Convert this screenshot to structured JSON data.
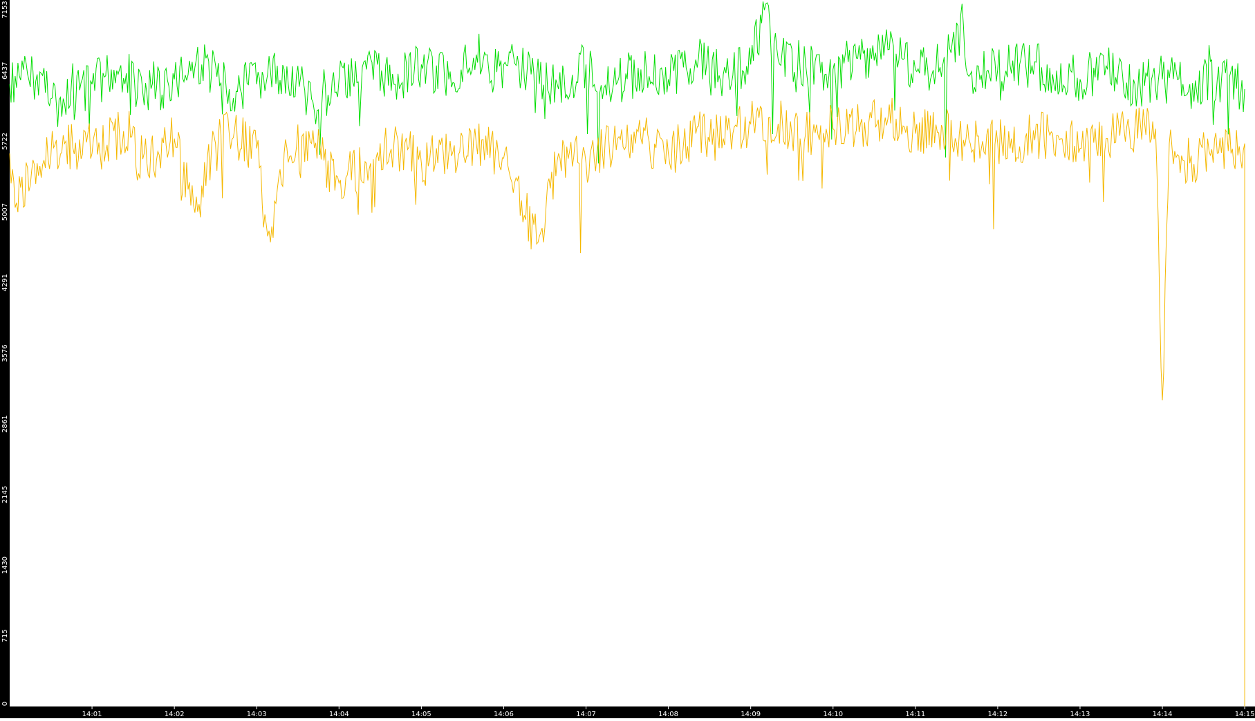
{
  "chart_data": {
    "type": "line",
    "title": "",
    "xlabel": "",
    "ylabel": "",
    "ylim": [
      0,
      7153
    ],
    "xlim": [
      "14:00",
      "14:15"
    ],
    "grid": false,
    "legend": "none",
    "y_ticks": [
      "0",
      "715",
      "1430",
      "2145",
      "2861",
      "3576",
      "4291",
      "5007",
      "5722",
      "6437",
      "7153"
    ],
    "x_ticks": [
      "14:01",
      "14:02",
      "14:03",
      "14:04",
      "14:05",
      "14:06",
      "14:07",
      "14:08",
      "14:09",
      "14:10",
      "14:11",
      "14:12",
      "14:13",
      "14:14",
      "14:15"
    ],
    "series": [
      {
        "color": "#00dd00",
        "points": [
          [
            "14:00",
            6300
          ],
          [
            "14:00:20",
            6400
          ],
          [
            "14:00:40",
            6100
          ],
          [
            "14:01",
            6300
          ],
          [
            "14:01:20",
            6450
          ],
          [
            "14:01:40",
            6200
          ],
          [
            "14:02",
            6350
          ],
          [
            "14:02:20",
            6500
          ],
          [
            "14:02:40",
            6250
          ],
          [
            "14:03",
            6300
          ],
          [
            "14:03:20",
            6450
          ],
          [
            "14:03:40",
            6150
          ],
          [
            "14:04",
            6350
          ],
          [
            "14:04:20",
            6450
          ],
          [
            "14:04:40",
            6300
          ],
          [
            "14:05",
            6500
          ],
          [
            "14:05:20",
            6350
          ],
          [
            "14:05:40",
            6600
          ],
          [
            "14:06",
            6500
          ],
          [
            "14:06:20",
            6400
          ],
          [
            "14:06:40",
            6250
          ],
          [
            "14:07",
            6500
          ],
          [
            "14:07:20",
            6300
          ],
          [
            "14:07:40",
            6450
          ],
          [
            "14:08",
            6350
          ],
          [
            "14:08:20",
            6550
          ],
          [
            "14:08:40",
            6400
          ],
          [
            "14:09",
            6500
          ],
          [
            "14:09:10",
            7050
          ],
          [
            "14:09:20",
            6550
          ],
          [
            "14:09:40",
            6500
          ],
          [
            "14:10",
            6450
          ],
          [
            "14:10:20",
            6550
          ],
          [
            "14:10:40",
            6650
          ],
          [
            "14:11",
            6450
          ],
          [
            "14:11:20",
            6500
          ],
          [
            "14:11:35",
            6900
          ],
          [
            "14:11:40",
            6400
          ],
          [
            "14:12",
            6450
          ],
          [
            "14:12:20",
            6550
          ],
          [
            "14:12:40",
            6400
          ],
          [
            "14:13",
            6350
          ],
          [
            "14:13:20",
            6450
          ],
          [
            "14:13:40",
            6300
          ],
          [
            "14:14",
            6350
          ],
          [
            "14:14:20",
            6300
          ],
          [
            "14:14:40",
            6350
          ],
          [
            "14:15",
            6250
          ]
        ]
      },
      {
        "color": "#f5b800",
        "points": [
          [
            "14:00",
            5600
          ],
          [
            "14:00:05",
            5100
          ],
          [
            "14:00:20",
            5500
          ],
          [
            "14:00:40",
            5700
          ],
          [
            "14:01",
            5600
          ],
          [
            "14:01:20",
            5800
          ],
          [
            "14:01:40",
            5500
          ],
          [
            "14:02",
            5750
          ],
          [
            "14:02:15",
            5000
          ],
          [
            "14:02:30",
            5700
          ],
          [
            "14:02:40",
            5800
          ],
          [
            "14:03",
            5650
          ],
          [
            "14:03:10",
            4700
          ],
          [
            "14:03:20",
            5600
          ],
          [
            "14:03:40",
            5700
          ],
          [
            "14:04",
            5300
          ],
          [
            "14:04:20",
            5500
          ],
          [
            "14:04:40",
            5700
          ],
          [
            "14:05",
            5500
          ],
          [
            "14:05:20",
            5600
          ],
          [
            "14:05:40",
            5700
          ],
          [
            "14:06",
            5550
          ],
          [
            "14:06:25",
            4700
          ],
          [
            "14:06:40",
            5600
          ],
          [
            "14:07",
            5500
          ],
          [
            "14:07:20",
            5700
          ],
          [
            "14:07:40",
            5750
          ],
          [
            "14:08",
            5600
          ],
          [
            "14:08:20",
            5800
          ],
          [
            "14:08:40",
            5750
          ],
          [
            "14:09",
            5900
          ],
          [
            "14:09:20",
            5900
          ],
          [
            "14:09:40",
            5800
          ],
          [
            "14:10",
            5850
          ],
          [
            "14:10:20",
            5900
          ],
          [
            "14:10:40",
            5950
          ],
          [
            "14:11",
            5800
          ],
          [
            "14:11:20",
            5850
          ],
          [
            "14:11:40",
            5700
          ],
          [
            "14:12",
            5700
          ],
          [
            "14:12:20",
            5750
          ],
          [
            "14:12:40",
            5800
          ],
          [
            "14:13",
            5650
          ],
          [
            "14:13:20",
            5750
          ],
          [
            "14:13:40",
            5850
          ],
          [
            "14:13:55",
            5850
          ],
          [
            "14:14",
            3100
          ],
          [
            "14:14:05",
            5700
          ],
          [
            "14:14:20",
            5500
          ],
          [
            "14:14:40",
            5600
          ],
          [
            "14:15",
            5700
          ],
          [
            "14:15",
            0
          ]
        ]
      }
    ]
  }
}
